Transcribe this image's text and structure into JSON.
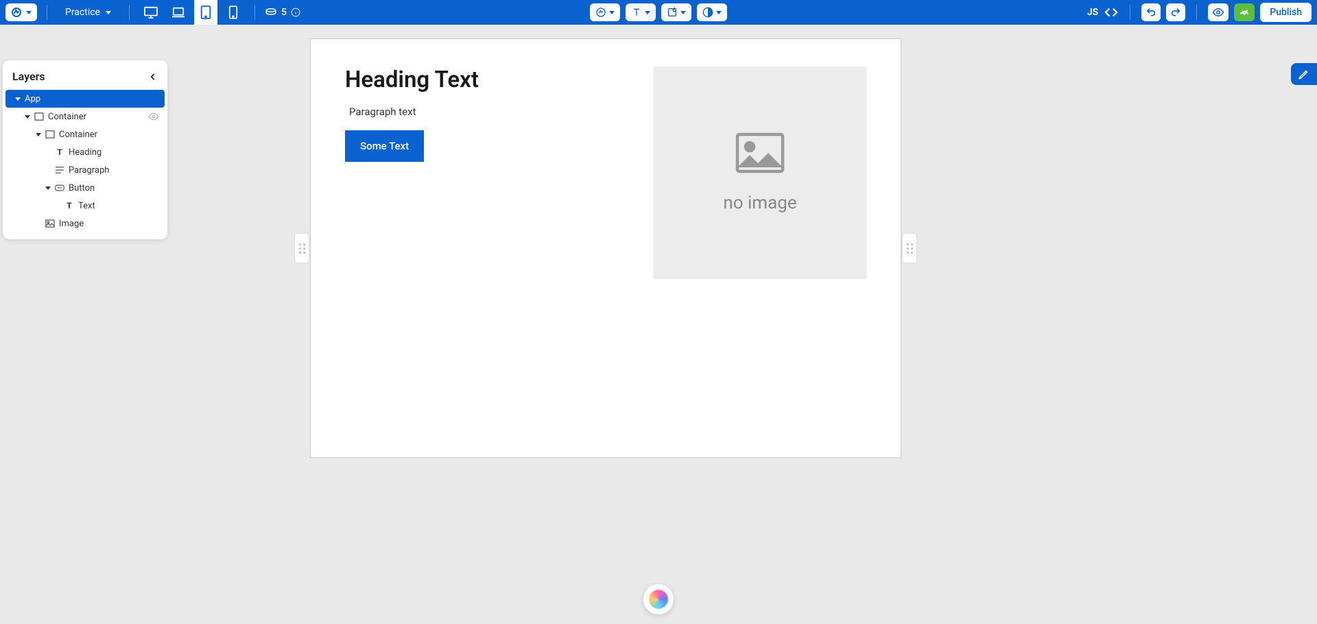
{
  "topbar": {
    "project_name": "Practice",
    "credits": "5",
    "publish_label": "Publish",
    "js_label": "JS"
  },
  "layers": {
    "title": "Layers",
    "tree": {
      "root": "App",
      "lvl1_container": "Container",
      "lvl2_container": "Container",
      "heading": "Heading",
      "paragraph": "Paragraph",
      "button": "Button",
      "text": "Text",
      "image": "Image"
    }
  },
  "canvas": {
    "heading": "Heading Text",
    "paragraph": "Paragraph text",
    "button_text": "Some Text",
    "image_placeholder": "no image"
  }
}
